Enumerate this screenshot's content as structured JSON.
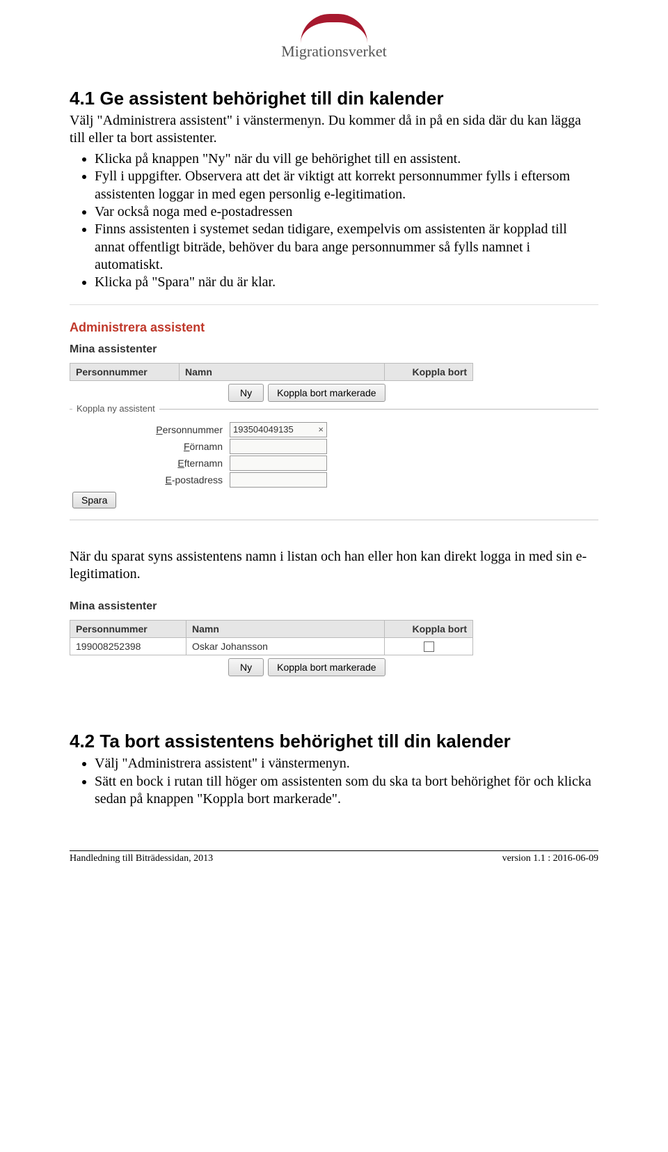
{
  "logo": {
    "text": "Migrationsverket"
  },
  "section1": {
    "heading": "4.1  Ge assistent behörighet till din kalender",
    "intro": "Välj \"Administrera assistent\" i vänstermenyn. Du kommer då in på en sida där du kan lägga till eller ta bort assistenter.",
    "bullets": [
      "Klicka på knappen \"Ny\" när du vill ge behörighet till en assistent.",
      "Fyll i uppgifter. Observera att det är viktigt att korrekt personnummer fylls i eftersom assistenten loggar in med egen personlig e-legitimation.",
      "Var också noga med e-postadressen",
      "Finns assistenten i systemet sedan tidigare, exempelvis om assistenten är kopplad till annat offentligt biträde, behöver du bara ange personnummer så fylls namnet i automatiskt.",
      "Klicka på \"Spara\" när du är klar."
    ]
  },
  "ui1": {
    "title": "Administrera assistent",
    "subtitle": "Mina assistenter",
    "table_headers": {
      "c1": "Personnummer",
      "c2": "Namn",
      "c3": "Koppla bort"
    },
    "btn_ny": "Ny",
    "btn_kb": "Koppla bort markerade",
    "fieldset_title": "Koppla ny assistent",
    "labels": {
      "pn_pre": "P",
      "pn_rest": "ersonnummer",
      "fn_pre": "F",
      "fn_rest": "örnamn",
      "en_pre": "E",
      "en_rest": "fternamn",
      "ep_pre": "E",
      "ep_rest": "-postadress"
    },
    "pn_value": "193504049135",
    "btn_spara": "Spara"
  },
  "midtext": "När du sparat syns assistentens namn i listan och han eller hon kan direkt logga in med sin e-legitimation.",
  "ui2": {
    "subtitle": "Mina assistenter",
    "table_headers": {
      "c1": "Personnummer",
      "c2": "Namn",
      "c3": "Koppla bort"
    },
    "row": {
      "pn": "199008252398",
      "namn": "Oskar Johansson"
    },
    "btn_ny": "Ny",
    "btn_kb": "Koppla bort markerade"
  },
  "section2": {
    "heading": "4.2  Ta bort assistentens behörighet till din kalender",
    "bullets": [
      "Välj \"Administrera assistent\" i vänstermenyn.",
      "Sätt en bock i rutan till höger om assistenten som du ska ta bort behörighet för och klicka sedan på knappen \"Koppla bort markerade\"."
    ]
  },
  "footer": {
    "left": "Handledning till Biträdessidan, 2013",
    "right": "version 1.1 : 2016-06-09"
  }
}
